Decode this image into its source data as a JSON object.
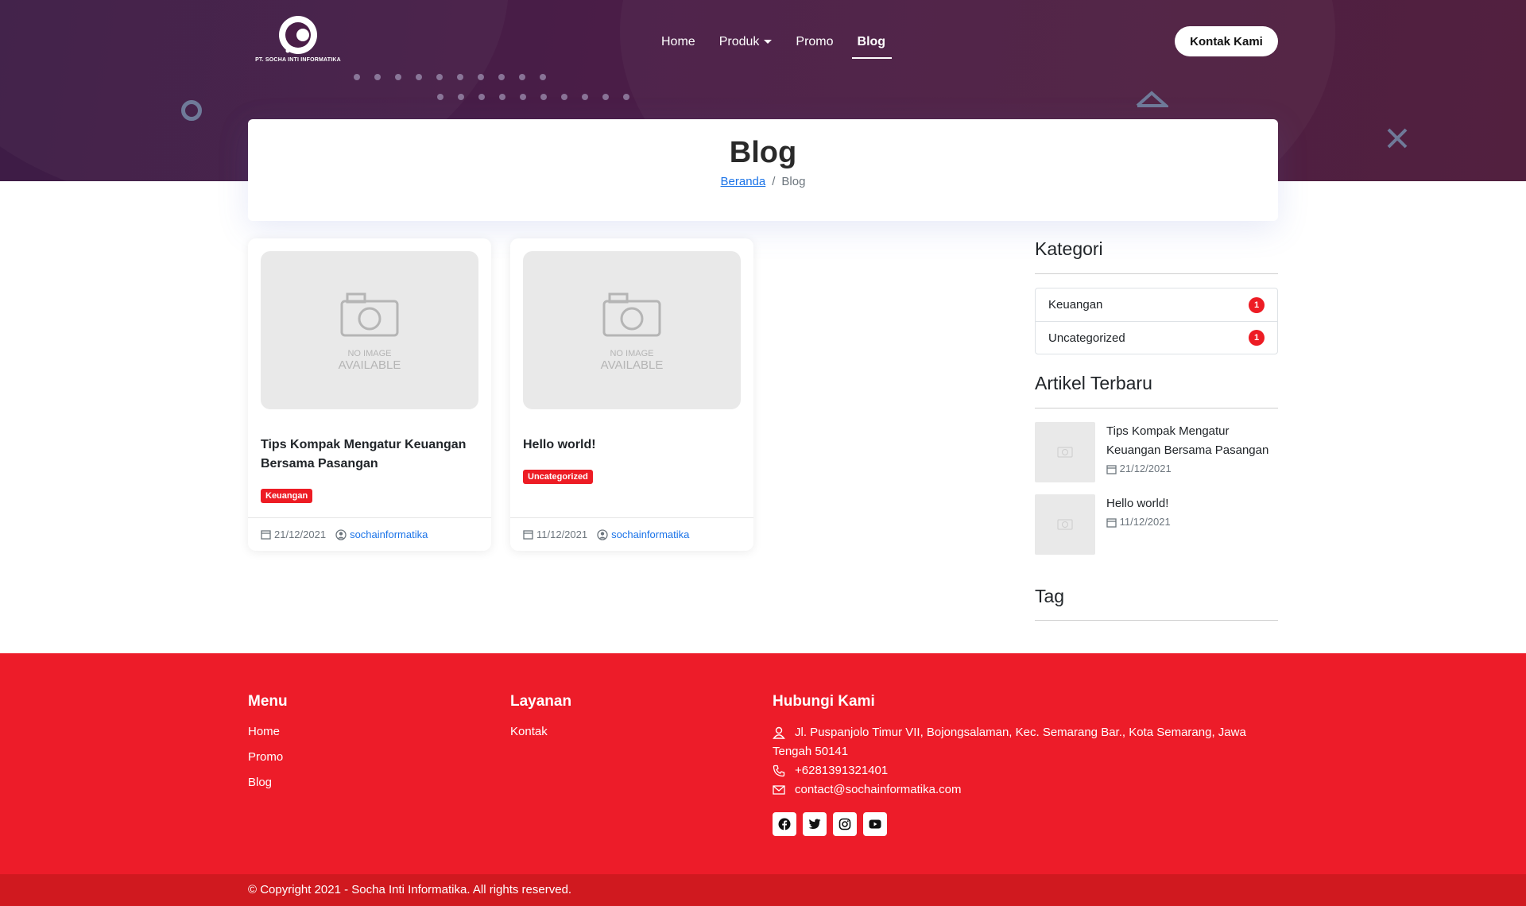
{
  "brand": {
    "logo_text": "PT. SOCHA INTI INFORMATIKA"
  },
  "nav": {
    "items": [
      {
        "label": "Home"
      },
      {
        "label": "Produk"
      },
      {
        "label": "Promo"
      },
      {
        "label": "Blog"
      }
    ],
    "contact_button": "Kontak Kami"
  },
  "page": {
    "title": "Blog",
    "breadcrumb": {
      "home": "Beranda",
      "separator": "/",
      "current": "Blog"
    }
  },
  "posts": [
    {
      "noimg_line1": "NO IMAGE",
      "noimg_line2": "AVAILABLE",
      "title": "Tips Kompak Mengatur Keuangan Bersama Pasangan",
      "category": "Keuangan",
      "date": "21/12/2021",
      "author": "sochainformatika"
    },
    {
      "noimg_line1": "NO IMAGE",
      "noimg_line2": "AVAILABLE",
      "title": "Hello world!",
      "category": "Uncategorized",
      "date": "11/12/2021",
      "author": "sochainformatika"
    }
  ],
  "sidebar": {
    "categories_heading": "Kategori",
    "categories": [
      {
        "name": "Keuangan",
        "count": "1"
      },
      {
        "name": "Uncategorized",
        "count": "1"
      }
    ],
    "recent_heading": "Artikel Terbaru",
    "recent": [
      {
        "title": "Tips Kompak Mengatur Keuangan Bersama Pasangan",
        "date": "21/12/2021"
      },
      {
        "title": "Hello world!",
        "date": "11/12/2021"
      }
    ],
    "tag_heading": "Tag"
  },
  "footer": {
    "menu_heading": "Menu",
    "menu": [
      "Home",
      "Promo",
      "Blog"
    ],
    "services_heading": "Layanan",
    "services": [
      "Kontak"
    ],
    "contact_heading": "Hubungi Kami",
    "address": "Jl. Puspanjolo Timur VII, Bojongsalaman, Kec. Semarang Bar., Kota Semarang, Jawa Tengah 50141",
    "phone": "+6281391321401",
    "email": "contact@sochainformatika.com",
    "social": [
      "facebook-icon",
      "twitter-icon",
      "instagram-icon",
      "youtube-icon"
    ],
    "copyright": "© Copyright 2021 - Socha Inti Informatika. All rights reserved."
  },
  "colors": {
    "hero": "#4a1d47",
    "accent_red": "#ed1c24",
    "link_blue": "#1a73e8"
  }
}
